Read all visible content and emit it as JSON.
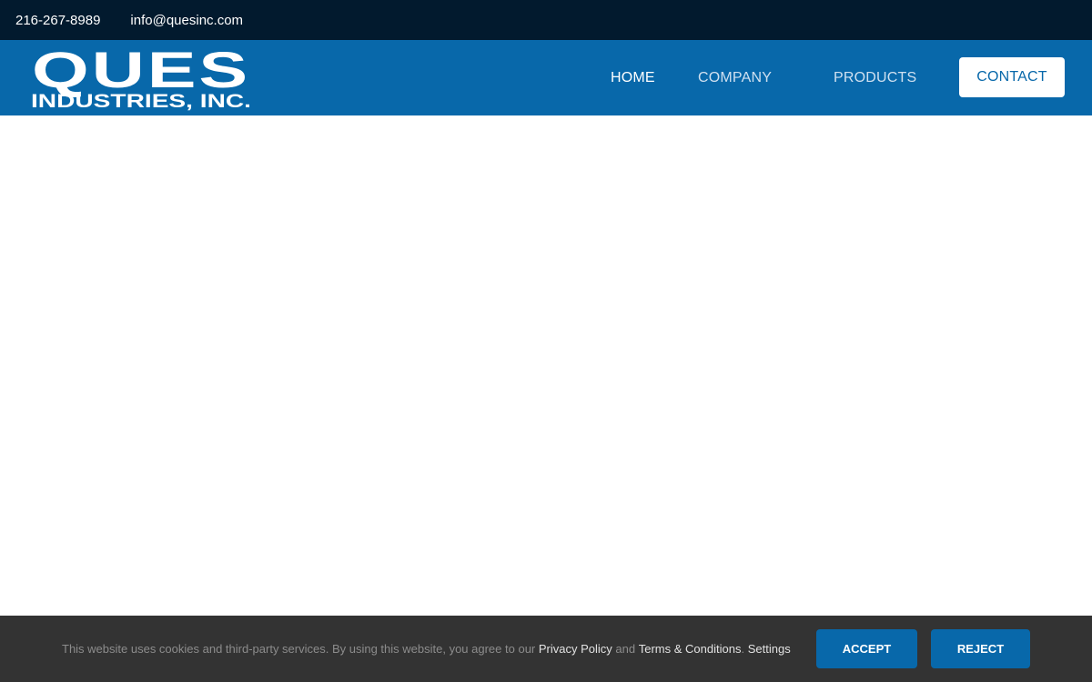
{
  "topbar": {
    "phone": "216-267-8989",
    "email": "info@quesinc.com"
  },
  "logo": {
    "line1": "QUES",
    "line2": "INDUSTRIES, INC."
  },
  "nav": {
    "items": [
      {
        "label": "HOME",
        "active": true
      },
      {
        "label": "COMPANY",
        "active": false
      },
      {
        "label": "PRODUCTS",
        "active": false
      }
    ],
    "contact_label": "CONTACT"
  },
  "cookie": {
    "text_before": "This website uses cookies and third-party services. By using this website, you agree to our ",
    "privacy_label": "Privacy Policy",
    "and_text": " and ",
    "terms_label": "Terms & Conditions",
    "period": ". ",
    "settings_label": "Settings",
    "accept_label": "ACCEPT",
    "reject_label": "REJECT"
  },
  "colors": {
    "topbar_bg": "#021a2e",
    "header_bg": "#0868aa",
    "cookie_bg": "#333333",
    "button_bg": "#0868aa"
  }
}
